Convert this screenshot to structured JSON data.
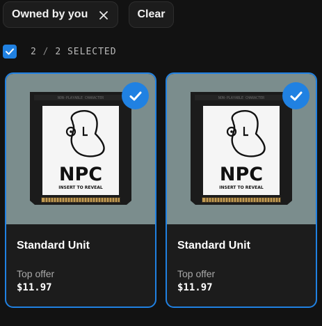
{
  "filters": {
    "owned_chip_label": "Owned by you",
    "owned_chip_icon": "close-icon",
    "clear_label": "Clear"
  },
  "selection": {
    "checkbox_icon": "checkmark-icon",
    "selected_count": "2",
    "separator": "/",
    "total_count": "2",
    "suffix": "SELECTED"
  },
  "cards": [
    {
      "name": "Standard Unit",
      "offer_label": "Top offer",
      "price": "$11.97",
      "selected": true,
      "cartridge_header": "NON-PLAYABLE CHARACTER",
      "cartridge_title": "NPC",
      "cartridge_subtitle": "INSERT TO REVEAL"
    },
    {
      "name": "Standard Unit",
      "offer_label": "Top offer",
      "price": "$11.97",
      "selected": true,
      "cartridge_header": "NON-PLAYABLE CHARACTER",
      "cartridge_title": "NPC",
      "cartridge_subtitle": "INSERT TO REVEAL"
    }
  ],
  "colors": {
    "accent": "#2081e2",
    "background": "#121212",
    "card_background": "#1c1c1c",
    "media_background": "#7b8d8d"
  }
}
